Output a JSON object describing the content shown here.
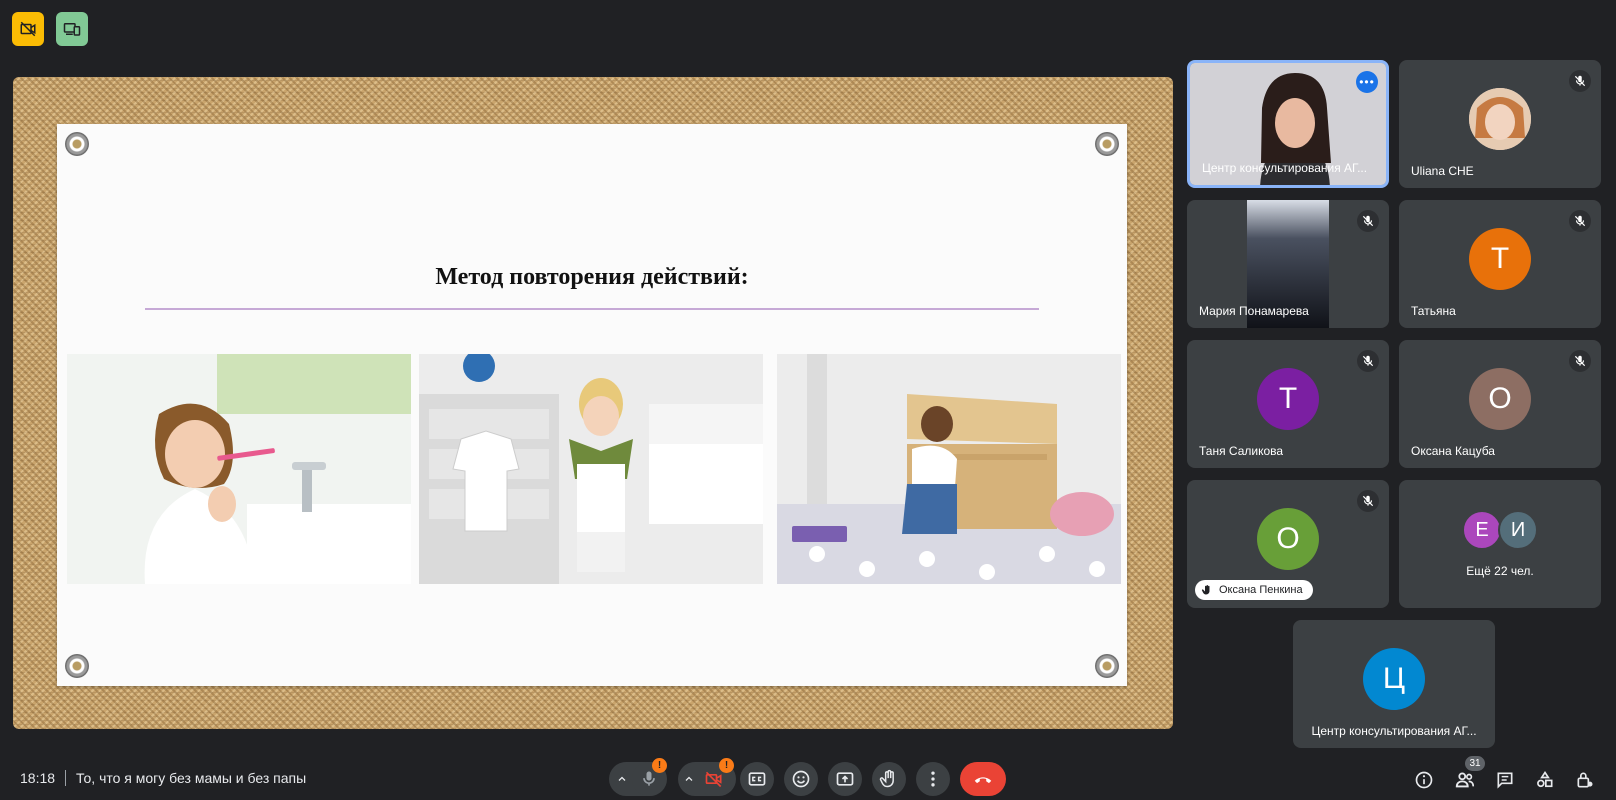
{
  "top_indicators": [
    {
      "icon": "no-camera-icon",
      "color": "#fbbc04"
    },
    {
      "icon": "devices-icon",
      "color": "#81c995"
    }
  ],
  "slide": {
    "title": "Метод повторения действий:"
  },
  "participants": [
    {
      "name": "Центр консультирования АГ...",
      "type": "video",
      "active": true
    },
    {
      "name": "Uliana CHE",
      "type": "photo",
      "muted": true
    },
    {
      "name": "Мария Понамарева",
      "type": "video",
      "muted": true
    },
    {
      "name": "Татьяна",
      "initial": "Т",
      "color": "#e8710a",
      "muted": true
    },
    {
      "name": "Таня Саликова",
      "initial": "Т",
      "color": "#7b1fa2",
      "muted": true
    },
    {
      "name": "Оксана Кацуба",
      "initial": "О",
      "color": "#8d6e63",
      "muted": true
    },
    {
      "name": "Оксана Пенкина",
      "initial": "О",
      "color": "#689f38",
      "muted": true,
      "hand_raised": true
    },
    {
      "more_label": "Ещё 22 чел.",
      "initials": [
        "Е",
        "И"
      ],
      "colors": [
        "#ab47bc",
        "#546e7a"
      ]
    },
    {
      "name": "Центр консультирования АГ...",
      "initial": "Ц",
      "color": "#0288d1"
    }
  ],
  "bottom_bar": {
    "time": "18:18",
    "meeting_title": "То, что я могу без мамы и без папы",
    "warning_mark": "!",
    "people_count": "31"
  }
}
